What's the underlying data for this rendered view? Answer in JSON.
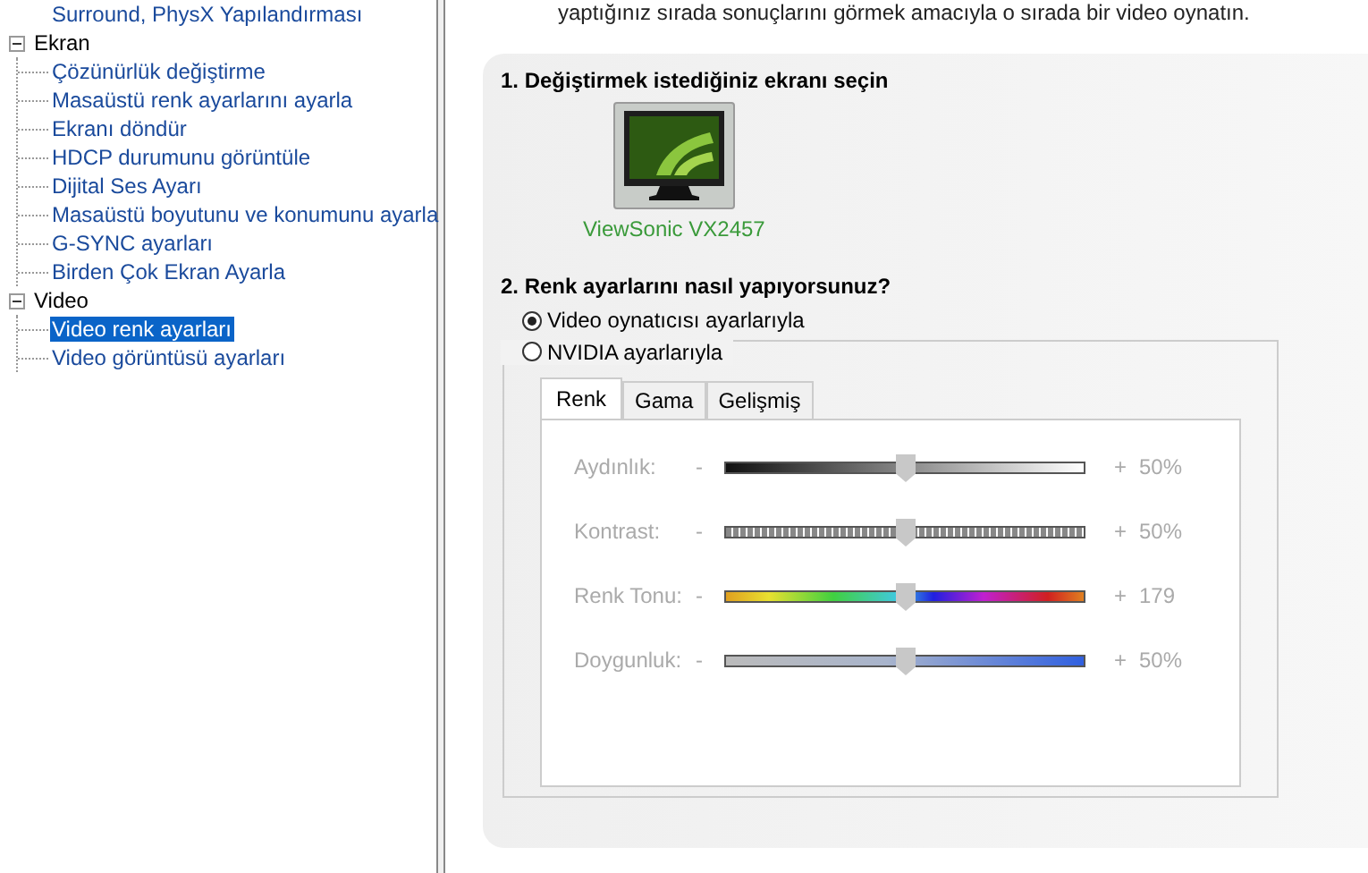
{
  "tree": [
    {
      "label": "Surround, PhysX Yapılandırması",
      "selected": false
    },
    {
      "label": "Ekran",
      "expanded": true,
      "children": [
        {
          "label": "Çözünürlük değiştirme",
          "selected": false
        },
        {
          "label": "Masaüstü renk ayarlarını ayarla",
          "selected": false
        },
        {
          "label": "Ekranı döndür",
          "selected": false
        },
        {
          "label": "HDCP durumunu görüntüle",
          "selected": false
        },
        {
          "label": "Dijital Ses Ayarı",
          "selected": false
        },
        {
          "label": "Masaüstü boyutunu ve konumunu ayarla",
          "selected": false
        },
        {
          "label": "G-SYNC ayarları",
          "selected": false
        },
        {
          "label": "Birden Çok Ekran Ayarla",
          "selected": false
        }
      ]
    },
    {
      "label": "Video",
      "expanded": true,
      "children": [
        {
          "label": "Video renk ayarları",
          "selected": true
        },
        {
          "label": "Video görüntüsü ayarları",
          "selected": false
        }
      ]
    }
  ],
  "intro": "yaptığınız sırada sonuçlarını görmek amacıyla o sırada bir video oynatın.",
  "section1": {
    "title": "1. Değiştirmek istediğiniz ekranı seçin",
    "displays": [
      {
        "label": "ViewSonic VX2457",
        "selected": true
      }
    ]
  },
  "section2": {
    "title": "2. Renk ayarlarını nasıl yapıyorsunuz?",
    "options": [
      {
        "label": "Video oynatıcısı ayarlarıyla",
        "selected": true
      },
      {
        "label": "NVIDIA ayarlarıyla",
        "selected": false
      }
    ],
    "tabs": [
      {
        "label": "Renk",
        "selected": true
      },
      {
        "label": "Gama",
        "selected": false
      },
      {
        "label": "Gelişmiş",
        "selected": false
      }
    ],
    "disabled": true,
    "sliders": [
      {
        "kind": "brightness",
        "label": "Aydınlık:",
        "minus": "-",
        "plus": "+",
        "level": 0.5,
        "reading": "50%"
      },
      {
        "kind": "contrast",
        "label": "Kontrast:",
        "minus": "-",
        "plus": "+",
        "level": 0.5,
        "reading": "50%"
      },
      {
        "kind": "hue",
        "label": "Renk Tonu:",
        "minus": "-",
        "plus": "+",
        "level": 0.5,
        "reading": "179"
      },
      {
        "kind": "saturation",
        "label": "Doygunluk:",
        "minus": "-",
        "plus": "+",
        "level": 0.5,
        "reading": "50%"
      }
    ]
  }
}
